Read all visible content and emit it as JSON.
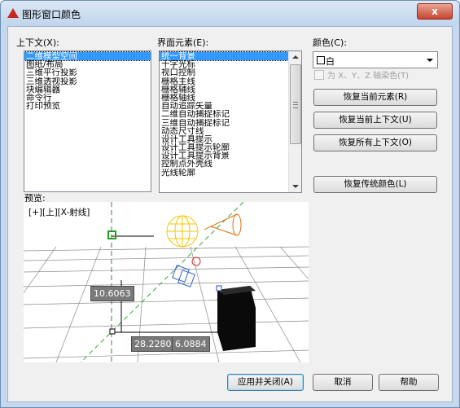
{
  "window": {
    "title": "图形窗口颜色",
    "close_glyph": "x"
  },
  "context": {
    "label": "上下文(X):",
    "items": [
      "二维模型空间",
      "图纸/布局",
      "三维平行投影",
      "三维透视投影",
      "块编辑器",
      "命令行",
      "打印预览"
    ],
    "selected_index": 0
  },
  "elements": {
    "label": "界面元素(E):",
    "items": [
      "统一背景",
      "十字光标",
      "视口控制",
      "栅格主线",
      "栅格辅线",
      "栅格轴线",
      "自动追踪矢量",
      "二维自动捕捉标记",
      "三维自动捕捉标记",
      "动态尺寸线",
      "设计工具提示",
      "设计工具提示轮廓",
      "设计工具提示背景",
      "控制点外壳线",
      "光线轮廓"
    ],
    "selected_index": 0
  },
  "color": {
    "label": "颜色(C):",
    "selected": "白",
    "tint_label": "为 X、Y、Z 轴染色(T)"
  },
  "buttons": {
    "restore_element": "恢复当前元素(R)",
    "restore_context": "恢复当前上下文(U)",
    "restore_all": "恢复所有上下文(O)",
    "restore_classic": "恢复传统颜色(L)",
    "apply_close": "应用并关闭(A)",
    "cancel": "取消",
    "help": "帮助"
  },
  "preview": {
    "label": "预览:",
    "viewport_label": "[+][上][X-射线]",
    "dim_vertical": "10.6063",
    "dim_horizontal_1": "28.2280",
    "dim_horizontal_2": "6.0884"
  }
}
